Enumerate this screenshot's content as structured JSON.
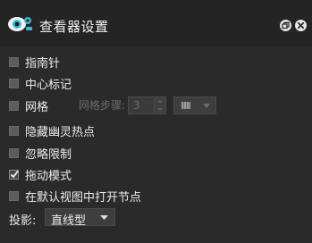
{
  "window": {
    "title": "查看器设置",
    "app_icon": "eye-settings-icon",
    "restore_icon": "restore-icon",
    "close_icon": "close-icon"
  },
  "options": [
    {
      "label": "指南针",
      "checked": false
    },
    {
      "label": "中心标记",
      "checked": false
    },
    {
      "label": "网格",
      "checked": false
    },
    {
      "label": "隐藏幽灵热点",
      "checked": false
    },
    {
      "label": "忽略限制",
      "checked": false
    },
    {
      "label": "拖动模式",
      "checked": true
    },
    {
      "label": "在默认视图中打开节点",
      "checked": false
    }
  ],
  "grid": {
    "step_label": "网格步骤:",
    "step_value": "3",
    "color_icon": "grid-color-swatch"
  },
  "projection": {
    "label": "投影:",
    "value": "直线型"
  },
  "colors": {
    "background": "#2a2a2a",
    "titlebar": "#242424",
    "accent_cyan": "#3fb8d8"
  }
}
